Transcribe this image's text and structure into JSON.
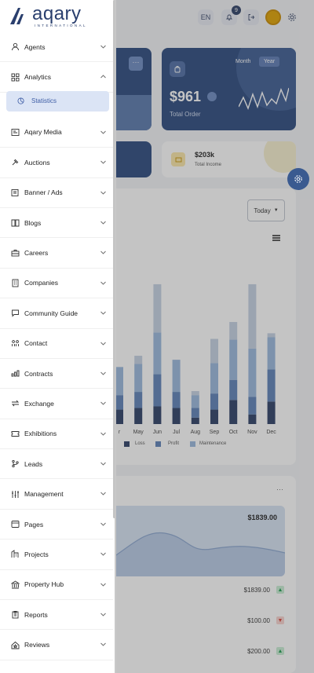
{
  "header": {
    "lang_label": "EN",
    "notification_count": "9"
  },
  "logo": {
    "text": "aqary",
    "subtitle": "INTERNATIONAL"
  },
  "order_card": {
    "amount": "$961",
    "label": "Total Order",
    "period_month": "Month",
    "period_year": "Year"
  },
  "income_card": {
    "amount": "$203k",
    "label": "Total Income"
  },
  "chart_card": {
    "filter_label": "Today"
  },
  "chart_data": {
    "type": "bar",
    "stacked": true,
    "categories": [
      "Apr",
      "May",
      "Jun",
      "Jul",
      "Aug",
      "Sep",
      "Oct",
      "Nov",
      "Dec"
    ],
    "visible_category_labels": [
      "r",
      "May",
      "Jun",
      "Jul",
      "Aug",
      "Sep",
      "Oct",
      "Nov",
      "Dec"
    ],
    "series": [
      {
        "name": "Loss",
        "values": [
          18,
          20,
          22,
          20,
          8,
          18,
          30,
          12,
          28
        ],
        "color": "#2d3f66"
      },
      {
        "name": "Profit",
        "values": [
          18,
          20,
          40,
          20,
          12,
          20,
          25,
          22,
          40
        ],
        "color": "#5e82b8"
      },
      {
        "name": "",
        "values": [
          35,
          35,
          52,
          40,
          16,
          38,
          50,
          60,
          40
        ],
        "color": "#9ab8dd"
      },
      {
        "name": "Maintenance",
        "values": [
          0,
          10,
          60,
          0,
          5,
          30,
          22,
          80,
          5
        ],
        "color": "#c5d1e3"
      }
    ],
    "legend": [
      "",
      "Loss",
      "Profit",
      "Maintenance"
    ],
    "legend_visible_text": [
      "t",
      "Loss",
      "Profit",
      "Maintenance"
    ]
  },
  "area_card": {
    "value": "$1839.00"
  },
  "transactions": [
    {
      "amount": "$1839.00",
      "direction": "up"
    },
    {
      "amount": "$100.00",
      "direction": "down"
    },
    {
      "amount": "$200.00",
      "direction": "up"
    }
  ],
  "sidebar": {
    "items": [
      {
        "label": "Agents",
        "icon": "user-icon"
      },
      {
        "label": "Analytics",
        "icon": "grid-icon",
        "expanded": true
      },
      {
        "label": "Aqary Media",
        "icon": "media-icon"
      },
      {
        "label": "Auctions",
        "icon": "gavel-icon"
      },
      {
        "label": "Banner / Ads",
        "icon": "banner-icon"
      },
      {
        "label": "Blogs",
        "icon": "book-icon"
      },
      {
        "label": "Careers",
        "icon": "briefcase-icon"
      },
      {
        "label": "Companies",
        "icon": "building-icon"
      },
      {
        "label": "Community Guide",
        "icon": "chat-icon"
      },
      {
        "label": "Contact",
        "icon": "contact-icon"
      },
      {
        "label": "Contracts",
        "icon": "contract-icon"
      },
      {
        "label": "Exchange",
        "icon": "exchange-icon"
      },
      {
        "label": "Exhibitions",
        "icon": "ticket-icon"
      },
      {
        "label": "Leads",
        "icon": "branch-icon"
      },
      {
        "label": "Management",
        "icon": "sliders-icon"
      },
      {
        "label": "Pages",
        "icon": "pages-icon"
      },
      {
        "label": "Projects",
        "icon": "projects-icon"
      },
      {
        "label": "Property Hub",
        "icon": "bank-icon"
      },
      {
        "label": "Reports",
        "icon": "clipboard-icon"
      },
      {
        "label": "Reviews",
        "icon": "home-star-icon"
      }
    ],
    "sub_items": [
      {
        "label": "Statistics",
        "icon": "chart-circle-icon"
      }
    ]
  }
}
